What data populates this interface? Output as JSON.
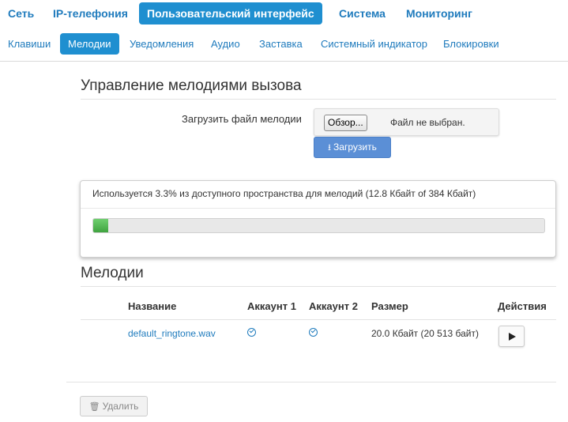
{
  "top_nav": [
    {
      "label": "Сеть",
      "active": false
    },
    {
      "label": "IP-телефония",
      "active": false
    },
    {
      "label": "Пользовательский интерфейс",
      "active": true
    },
    {
      "label": "Система",
      "active": false
    },
    {
      "label": "Мониторинг",
      "active": false
    }
  ],
  "sub_nav": [
    {
      "label": "Клавиши",
      "active": false
    },
    {
      "label": "Мелодии",
      "active": true
    },
    {
      "label": "Уведомления",
      "active": false
    },
    {
      "label": "Аудио",
      "active": false
    },
    {
      "label": "Заставка",
      "active": false
    },
    {
      "label": "Системный индикатор",
      "active": false
    },
    {
      "label": "Блокировки",
      "active": false
    }
  ],
  "manage": {
    "title": "Управление мелодиями вызова",
    "upload_label": "Загрузить файл мелодии",
    "browse_label": "Обзор...",
    "file_status": "Файл не выбран.",
    "upload_button": "Загрузить",
    "upload_icon": "download-icon"
  },
  "usage": {
    "text": "Используется 3.3% из доступного пространства для мелодий (12.8 Кбайт of 384 Кбайт)",
    "percent": 3.3,
    "bar_color": "#4cb84c"
  },
  "melodies": {
    "title": "Мелодии",
    "headers": {
      "name": "Название",
      "account1": "Аккаунт 1",
      "account2": "Аккаунт 2",
      "size": "Размер",
      "actions": "Действия"
    },
    "rows": [
      {
        "name": "default_ringtone.wav",
        "account1": true,
        "account2": true,
        "size": "20.0 Кбайт (20 513 байт)",
        "action_icon": "play-icon"
      }
    ]
  },
  "delete_button": "Удалить",
  "delete_icon": "trash-icon",
  "colors": {
    "accent": "#1f8fd0",
    "link": "#1f7bbd",
    "upload_button": "#5b8fd6"
  }
}
